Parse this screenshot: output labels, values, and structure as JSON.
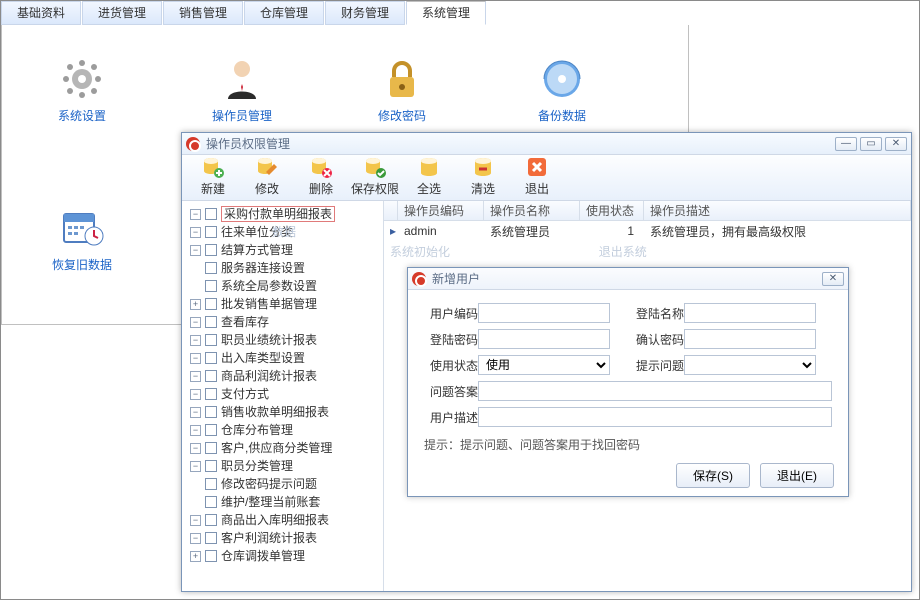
{
  "main_tabs": [
    "基础资料",
    "进货管理",
    "销售管理",
    "仓库管理",
    "财务管理",
    "系统管理"
  ],
  "main_active_tab": 5,
  "main_icons_row1": [
    {
      "name": "系统设置",
      "icon": "gear"
    },
    {
      "name": "操作员管理",
      "icon": "user"
    },
    {
      "name": "修改密码",
      "icon": "lock"
    },
    {
      "name": "备份数据",
      "icon": "disk"
    }
  ],
  "main_icons_row2": [
    {
      "name": "恢复旧数据",
      "icon": "calendar"
    }
  ],
  "perm_window": {
    "title": "操作员权限管理",
    "toolbar": [
      {
        "label": "新建",
        "icon": "db-plus"
      },
      {
        "label": "修改",
        "icon": "db-edit"
      },
      {
        "label": "删除",
        "icon": "db-del"
      },
      {
        "label": "保存权限",
        "icon": "db-save"
      },
      {
        "label": "全选",
        "icon": "db-all"
      },
      {
        "label": "清选",
        "icon": "db-clear"
      },
      {
        "label": "退出",
        "icon": "exit"
      }
    ],
    "tree": [
      {
        "label": "采购付款单明细报表",
        "expandable": "minus",
        "selected": true
      },
      {
        "label": "往来单位分类",
        "expandable": "minus",
        "ghost": "数据"
      },
      {
        "label": "结算方式管理",
        "expandable": "minus"
      },
      {
        "label": "服务器连接设置",
        "expandable": "none"
      },
      {
        "label": "系统全局参数设置",
        "expandable": "none"
      },
      {
        "label": "批发销售单据管理",
        "expandable": "plus"
      },
      {
        "label": "查看库存",
        "expandable": "minus"
      },
      {
        "label": "职员业绩统计报表",
        "expandable": "minus"
      },
      {
        "label": "出入库类型设置",
        "expandable": "minus"
      },
      {
        "label": "商品利润统计报表",
        "expandable": "minus"
      },
      {
        "label": "支付方式",
        "expandable": "minus"
      },
      {
        "label": "销售收款单明细报表",
        "expandable": "minus"
      },
      {
        "label": "仓库分布管理",
        "expandable": "minus"
      },
      {
        "label": "客户,供应商分类管理",
        "expandable": "minus"
      },
      {
        "label": "职员分类管理",
        "expandable": "minus"
      },
      {
        "label": "修改密码提示问题",
        "expandable": "none"
      },
      {
        "label": "维护/整理当前账套",
        "expandable": "none"
      },
      {
        "label": "商品出入库明细报表",
        "expandable": "minus"
      },
      {
        "label": "客户利润统计报表",
        "expandable": "minus"
      },
      {
        "label": "仓库调拨单管理",
        "expandable": "plus"
      }
    ],
    "grid_headers": [
      "操作员编码",
      "操作员名称",
      "使用状态",
      "操作员描述"
    ],
    "grid_row": {
      "code": "admin",
      "name": "系统管理员",
      "status": "1",
      "desc": "系统管理员，拥有最高级权限"
    },
    "ghost_labels": [
      "系统初始化",
      "退出系统"
    ]
  },
  "dialog": {
    "title": "新增用户",
    "fields": {
      "user_code": "用户编码",
      "login_name": "登陆名称",
      "login_pwd": "登陆密码",
      "confirm_pwd": "确认密码",
      "use_state": "使用状态",
      "use_state_value": "使用",
      "hint_q": "提示问题",
      "hint_a": "问题答案",
      "user_desc": "用户描述"
    },
    "hint": "提示：提示问题、问题答案用于找回密码",
    "btn_save": "保存(S)",
    "btn_exit": "退出(E)"
  }
}
